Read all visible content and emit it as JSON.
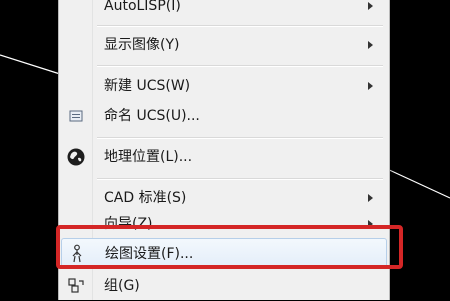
{
  "canvas": {
    "background": "#000000",
    "line_color": "#ffffff"
  },
  "menu": {
    "items": [
      {
        "label": "AutoLISP(I)",
        "icon": "",
        "submenu": true
      },
      {
        "label": "显示图像(Y)",
        "icon": "",
        "submenu": true
      },
      {
        "label": "新建 UCS(W)",
        "icon": "",
        "submenu": true
      },
      {
        "label": "命名 UCS(U)...",
        "icon": "ucs-icon",
        "submenu": false
      },
      {
        "label": "地理位置(L)...",
        "icon": "globe-icon",
        "submenu": false
      },
      {
        "label": "CAD 标准(S)",
        "icon": "",
        "submenu": true
      },
      {
        "label": "向导(Z)",
        "icon": "",
        "submenu": true
      },
      {
        "label": "绘图设置(F)...",
        "icon": "drafting-settings-icon",
        "submenu": false
      },
      {
        "label": "组(G)",
        "icon": "group-icon",
        "submenu": false
      }
    ],
    "hover_item": "绘图设置(F)...",
    "highlight_color": "#d42626"
  }
}
